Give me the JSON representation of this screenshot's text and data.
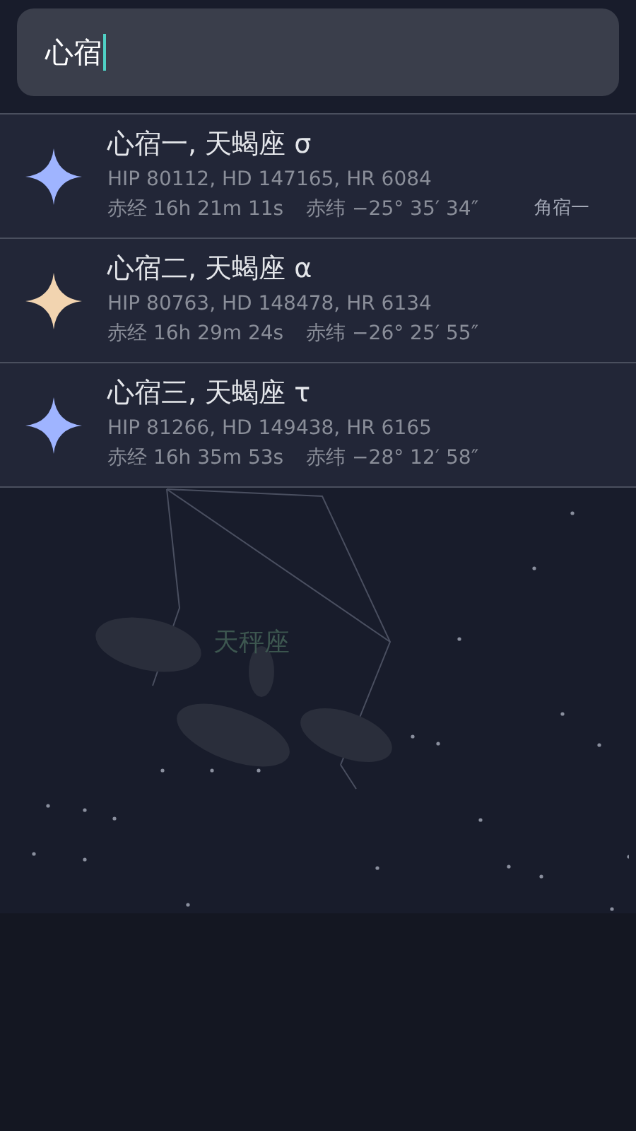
{
  "search": {
    "value": "心宿"
  },
  "results": [
    {
      "name": "心宿一, 天蝎座 σ",
      "catalog": "HIP 80112, HD 147165, HR 6084",
      "ra": "赤经 16h 21m 11s",
      "dec": "赤纬 −25° 35′ 34″",
      "color": "#9fb4ff"
    },
    {
      "name": "心宿二, 天蝎座 α",
      "catalog": "HIP 80763, HD 148478, HR 6134",
      "ra": "赤经 16h 29m 24s",
      "dec": "赤纬 −26° 25′ 55″",
      "color": "#f2d4b0"
    },
    {
      "name": "心宿三, 天蝎座 τ",
      "catalog": "HIP 81266, HD 149438, HR 6165",
      "ra": "赤经 16h 35m 53s",
      "dec": "赤纬 −28° 12′ 58″",
      "color": "#9fb4ff"
    }
  ],
  "sky_labels": [
    {
      "text": "角宿一",
      "kind": "star"
    },
    {
      "text": "天秤座",
      "kind": "constellation"
    }
  ]
}
